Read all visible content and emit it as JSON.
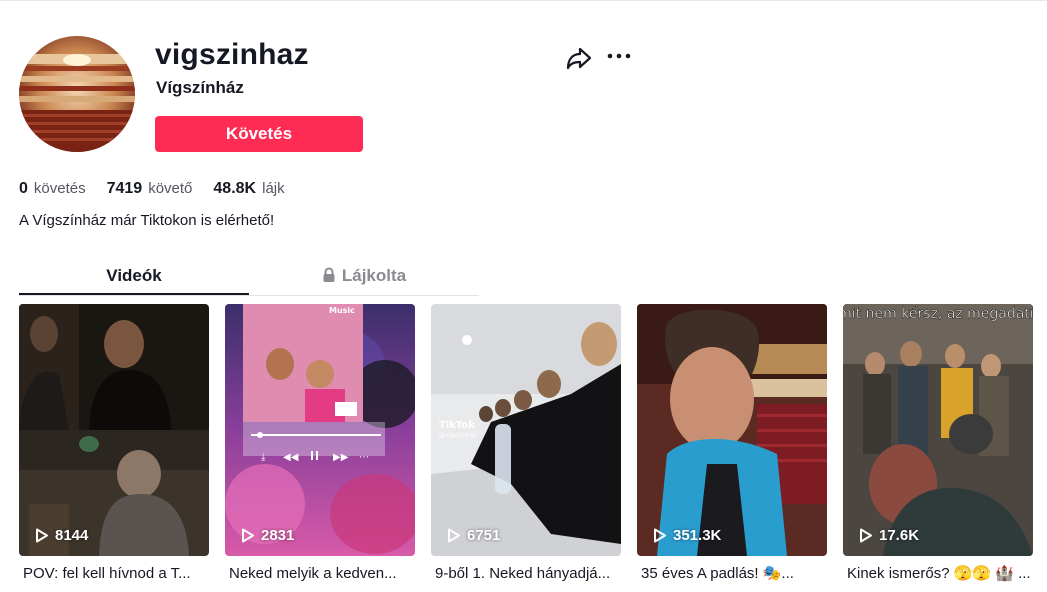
{
  "profile": {
    "username": "vigszinhaz",
    "nickname": "Vígszínház",
    "follow_label": "Követés",
    "bio": "A Vígszínház már Tiktokon is elérhető!"
  },
  "stats": {
    "following_count": "0",
    "following_label": "követés",
    "followers_count": "7419",
    "followers_label": "követő",
    "likes_count": "48.8K",
    "likes_label": "lájk"
  },
  "tabs": {
    "videos": "Videók",
    "liked": "Lájkolta"
  },
  "videos": [
    {
      "views": "8144",
      "caption": "POV: fel kell hívnod a T..."
    },
    {
      "views": "2831",
      "caption": "Neked melyik a kedven..."
    },
    {
      "views": "6751",
      "caption": "9-ből 1. Neked hányadjá..."
    },
    {
      "views": "351.3K",
      "caption": "35 éves A padlás! 🎭..."
    },
    {
      "views": "17.6K",
      "caption": "Kinek ismerős? 🫣🫣 🏰 ..."
    }
  ],
  "overlays": {
    "video2_music_tag": "Music",
    "video3_watermark": "TikTok",
    "video3_handle": "@vigszinhaz",
    "video5_text": "Amit nem kérsz, az megadatik!"
  },
  "colors": {
    "accent": "#fe2c55",
    "text": "#161823",
    "muted": "#8a8b91"
  },
  "icons": {
    "share": "share-arrow-icon",
    "more": "ellipsis-icon",
    "lock": "lock-icon",
    "play": "play-icon"
  }
}
